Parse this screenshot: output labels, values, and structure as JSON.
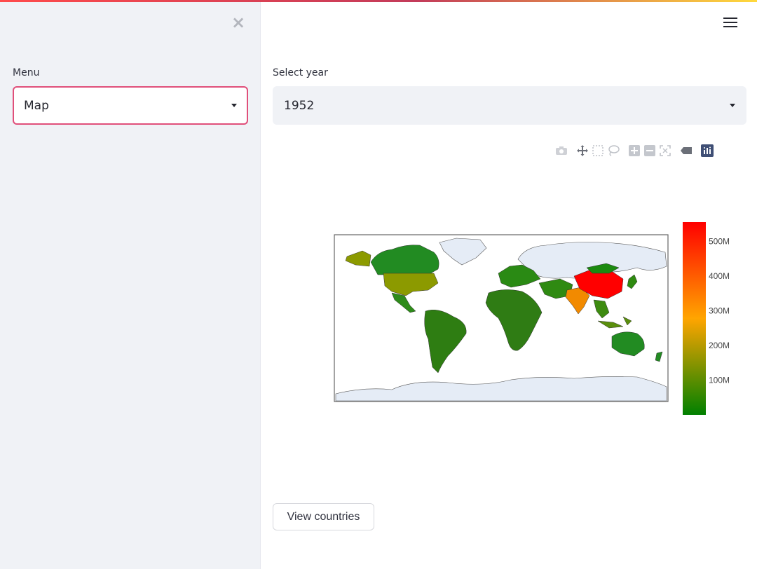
{
  "sidebar": {
    "menu_label": "Menu",
    "menu_value": "Map",
    "close_icon": "close-icon"
  },
  "main": {
    "year_label": "Select year",
    "year_value": "1952",
    "view_button": "View countries",
    "menu_icon": "hamburger-icon"
  },
  "modebar": {
    "icons": [
      "camera-icon",
      "pan-icon",
      "box-select-icon",
      "lasso-icon",
      "zoom-in-icon",
      "zoom-out-icon",
      "reset-icon",
      "hover-icon",
      "plotly-logo-icon"
    ]
  },
  "chart_data": {
    "type": "choropleth",
    "metric": "population",
    "year": 1952,
    "colorscale": [
      "#008000",
      "#ffa500",
      "#ff0000"
    ],
    "colorbar": {
      "ticks": [
        "100M",
        "200M",
        "300M",
        "400M",
        "500M"
      ],
      "values": [
        100000000,
        200000000,
        300000000,
        400000000,
        500000000
      ],
      "range": [
        0,
        556000000
      ]
    },
    "highlighted": [
      {
        "country": "China",
        "value": 556000000,
        "color": "#ff0000"
      },
      {
        "country": "India",
        "value": 372000000,
        "color": "#f28a00"
      },
      {
        "country": "United States",
        "value": 158000000,
        "color": "#8c9a00"
      }
    ]
  }
}
